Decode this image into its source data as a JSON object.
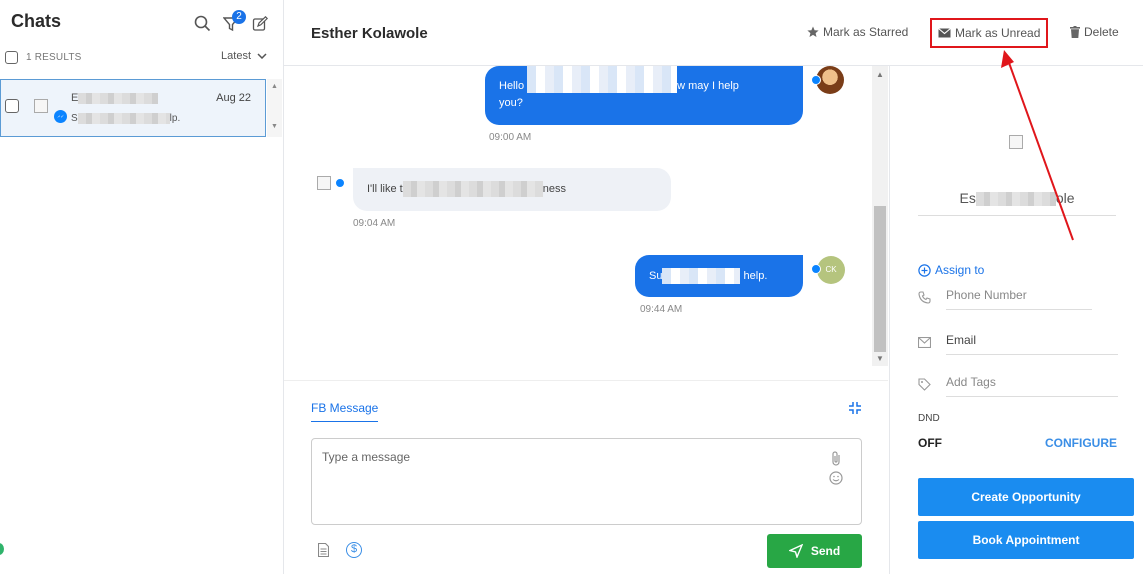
{
  "sidebar": {
    "title": "Chats",
    "filter_badge": "2",
    "results_count": "1 RESULTS",
    "sort_label": "Latest",
    "chat_item": {
      "name_visible": "E",
      "date": "Aug 22",
      "preview_start": "S",
      "preview_end": "lp."
    }
  },
  "header": {
    "contact_name": "Esther Kolawole",
    "mark_starred": "Mark as Starred",
    "mark_unread": "Mark as Unread",
    "delete": "Delete"
  },
  "messages": [
    {
      "direction": "out",
      "text_start": "Hello",
      "text_mid": "w may I help",
      "text_end": "you?",
      "time": "09:00 AM"
    },
    {
      "direction": "in",
      "text_start": "I'll like t",
      "text_end": "ness",
      "time": "09:04 AM"
    },
    {
      "direction": "out",
      "text_start": "Su",
      "text_end": "help.",
      "time": "09:44 AM",
      "avatar_initials": "CK"
    }
  ],
  "composer": {
    "tab_label": "FB Message",
    "placeholder": "Type a message",
    "send_label": "Send"
  },
  "contact_panel": {
    "name_start": "Es",
    "name_end": "ole",
    "assign_label": "Assign to",
    "phone_placeholder": "Phone Number",
    "email_label": "Email",
    "tags_placeholder": "Add Tags",
    "dnd_label": "DND",
    "dnd_value": "OFF",
    "configure_label": "CONFIGURE",
    "create_opportunity": "Create Opportunity",
    "book_appointment": "Book Appointment"
  },
  "colors": {
    "accent_blue": "#1a73e8",
    "send_green": "#28a745",
    "highlight_red": "#e0161b",
    "cta_blue": "#1a8cf0"
  },
  "icons": [
    "search-icon",
    "filter-icon",
    "compose-icon",
    "star-icon",
    "envelope-icon",
    "trash-icon",
    "messenger-icon",
    "paperclip-icon",
    "smile-icon",
    "document-icon",
    "dollar-icon",
    "send-icon",
    "collapse-icon",
    "phone-icon",
    "mail-icon",
    "tag-icon",
    "plus-circle-icon"
  ]
}
